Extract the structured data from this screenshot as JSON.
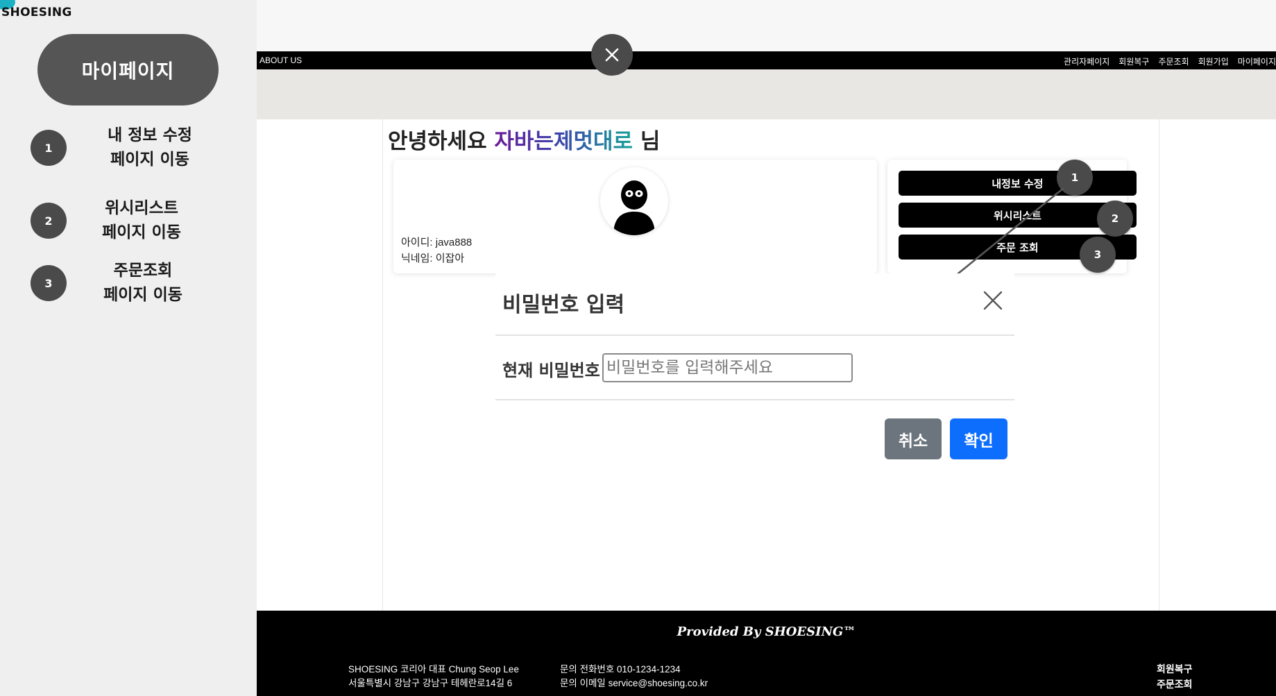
{
  "brand": "SHOESING",
  "guide": {
    "title": "마이페이지",
    "steps": [
      {
        "num": "1",
        "text": "내 정보 수정\n페이지 이동"
      },
      {
        "num": "2",
        "text": "위시리스트\n페이지 이동"
      },
      {
        "num": "3",
        "text": "주문조회\n페이지 이동"
      }
    ]
  },
  "nav": {
    "left": "ABOUT US",
    "right": [
      "관리자페이지",
      "회원복구",
      "주문조회",
      "회원가입",
      "마이페이지"
    ]
  },
  "greeting": {
    "prefix": "안녕하세요 ",
    "nickname": "자바는제멋대로",
    "suffix": " 님"
  },
  "profile": {
    "id_line": "아이디: java888",
    "nick_line": "닉네임: 이잡아"
  },
  "menu": {
    "edit": "내정보 수정",
    "wishlist": "위시리스트",
    "orders": "주문 조회"
  },
  "markers": [
    "1",
    "2",
    "3"
  ],
  "modal": {
    "title": "비밀번호 입력",
    "field_label": "현재 비밀번호",
    "placeholder": "비밀번호를 입력해주세요",
    "cancel": "취소",
    "confirm": "확인"
  },
  "footer": {
    "provided": "Provided By SHOESING™",
    "company": "SHOESING 코리아 대표 Chung Seop Lee",
    "address": "서울특별시 강남구 강남구 테헤란로14길 6",
    "phone": "문의 전화번호 010-1234-1234",
    "email": "문의 이메일 service@shoesing.co.kr",
    "links": [
      "회원복구",
      "주문조회"
    ]
  },
  "colors": {
    "accent_blue": "#0d6efd",
    "cancel_gray": "#6c757d",
    "marker_gray": "#4a4a4a"
  }
}
